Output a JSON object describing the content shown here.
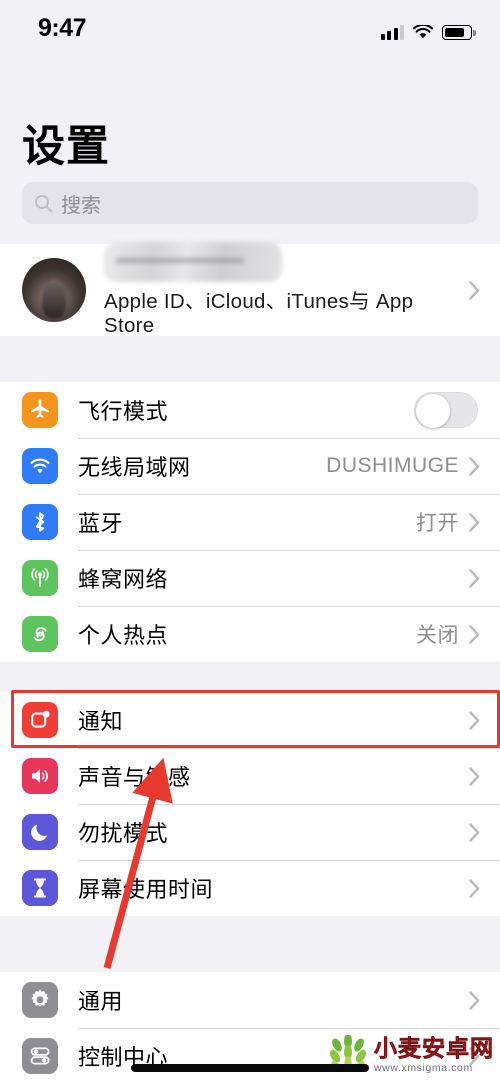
{
  "status_bar": {
    "time": "9:47",
    "cellular_icon": "signal-bars-icon",
    "wifi_icon": "wifi-icon",
    "battery_icon": "battery-icon"
  },
  "header": {
    "title": "设置"
  },
  "search": {
    "placeholder": "搜索",
    "icon": "search-icon"
  },
  "account": {
    "name": "",
    "subtitle": "Apple ID、iCloud、iTunes与 App Store",
    "avatar": "user-avatar",
    "chevron": "chevron-right-icon"
  },
  "groups": [
    {
      "id": "connectivity",
      "rows": [
        {
          "label": "飞行模式",
          "icon": "airplane-icon",
          "icon_color": "#f3951d",
          "accessory": "toggle",
          "toggle_on": false
        },
        {
          "label": "无线局域网",
          "icon": "wifi-icon",
          "icon_color": "#2f7cf6",
          "value": "DUSHIMUGE",
          "accessory": "chevron"
        },
        {
          "label": "蓝牙",
          "icon": "bluetooth-icon",
          "icon_color": "#2f7cf6",
          "value": "打开",
          "accessory": "chevron"
        },
        {
          "label": "蜂窝网络",
          "icon": "cellular-icon",
          "icon_color": "#5ec45e",
          "value": "",
          "accessory": "chevron"
        },
        {
          "label": "个人热点",
          "icon": "hotspot-icon",
          "icon_color": "#5ec45e",
          "value": "关闭",
          "accessory": "chevron"
        }
      ]
    },
    {
      "id": "alerts",
      "rows": [
        {
          "label": "通知",
          "icon": "notifications-icon",
          "icon_color": "#ef3e35",
          "value": "",
          "accessory": "chevron",
          "highlighted": true
        },
        {
          "label": "声音与触感",
          "icon": "sounds-icon",
          "icon_color": "#e8365d",
          "value": "",
          "accessory": "chevron"
        },
        {
          "label": "勿扰模式",
          "icon": "moon-icon",
          "icon_color": "#5c56d8",
          "value": "",
          "accessory": "chevron"
        },
        {
          "label": "屏幕使用时间",
          "icon": "hourglass-icon",
          "icon_color": "#5c56d8",
          "value": "",
          "accessory": "chevron"
        }
      ]
    },
    {
      "id": "system",
      "rows": [
        {
          "label": "通用",
          "icon": "gear-icon",
          "icon_color": "#8e8e93",
          "value": "",
          "accessory": "chevron"
        },
        {
          "label": "控制中心",
          "icon": "control-center-icon",
          "icon_color": "#8e8e93",
          "value": "",
          "accessory": "chevron"
        }
      ]
    }
  ],
  "annotations": {
    "highlight_box_color": "#e8392f",
    "arrow_color": "#e8392f",
    "arrow_target": "通知"
  },
  "watermark": {
    "site_name": "小麦安卓网",
    "url": "www.xmsigma.com",
    "logo": "wheat-logo-icon"
  }
}
